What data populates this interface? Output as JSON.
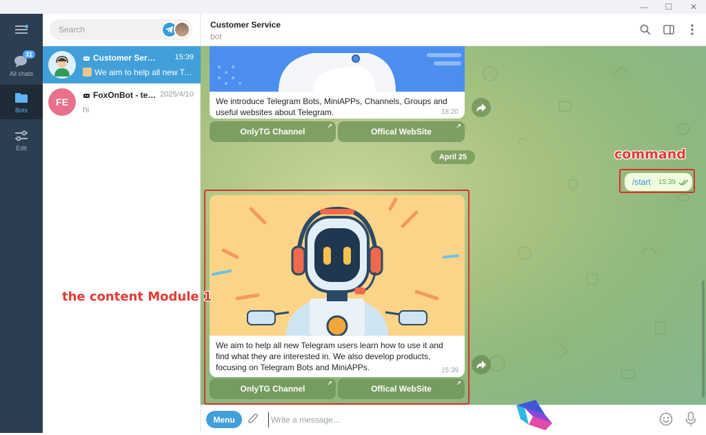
{
  "window": {
    "minimize": "—",
    "maximize": "☐",
    "close": "✕"
  },
  "rail": {
    "all_chats_label": "All chats",
    "all_chats_badge": "31",
    "bots_label": "Bots",
    "edit_label": "Edit"
  },
  "search": {
    "placeholder": "Search"
  },
  "chats": [
    {
      "name": "Customer Service",
      "time": "15:39",
      "preview": "We aim to help all new Tel...",
      "active": true
    },
    {
      "name": "FoxOnBot - tes...",
      "time": "2025/4/10",
      "preview": "hi",
      "initials": "FE"
    }
  ],
  "header": {
    "title": "Customer Service",
    "subtitle": "bot"
  },
  "messages": {
    "first_text": "We introduce Telegram Bots, MiniAPPs, Channels, Groups and useful websites about Telegram.",
    "first_time": "18:20",
    "date_divider": "April 25",
    "outgoing_text": "/start",
    "outgoing_time": "15:39",
    "second_text": "We aim to help all new Telegram users learn how to use it and find what they are interested in. We also develop products, focusing on Telegram Bots and MiniAPPs.",
    "second_time": "15:39"
  },
  "keyboard": {
    "channel_label": "OnlyTG Channel",
    "website_label": "Offical WebSite"
  },
  "annotations": {
    "command": "command",
    "module": "the content Module 1"
  },
  "composer": {
    "menu_label": "Menu",
    "placeholder": "Write a message..."
  },
  "colors": {
    "accent": "#419fd9",
    "annotation_red": "#d9312c",
    "rail_bg": "#2c3e50"
  }
}
